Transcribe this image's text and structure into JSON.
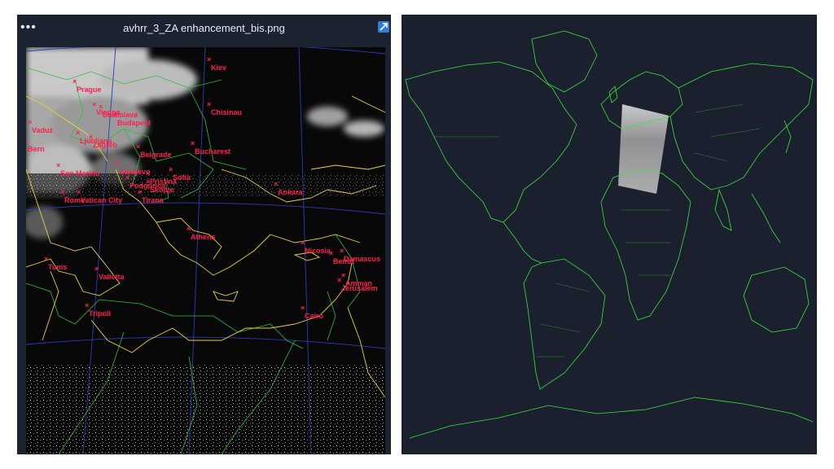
{
  "viewer": {
    "title": "avhrr_3_ZA enhancement_bis.png",
    "menu_icon": "more-dots-icon",
    "expand_icon": "open-external-icon",
    "menu_glyph": "•••"
  },
  "cities": [
    {
      "name": "Kiev"
    },
    {
      "name": "Prague"
    },
    {
      "name": "Vienna"
    },
    {
      "name": "Bratislava"
    },
    {
      "name": "Budapest"
    },
    {
      "name": "Chisinau"
    },
    {
      "name": "Vaduz"
    },
    {
      "name": "Bern"
    },
    {
      "name": "Ljubljana"
    },
    {
      "name": "Zagreb"
    },
    {
      "name": "Belgrade"
    },
    {
      "name": "Bucharest"
    },
    {
      "name": "Sarajevo"
    },
    {
      "name": "San Marino"
    },
    {
      "name": "Podgorica"
    },
    {
      "name": "Pristina"
    },
    {
      "name": "Sofia"
    },
    {
      "name": "Skopje"
    },
    {
      "name": "Tirana"
    },
    {
      "name": "Rome"
    },
    {
      "name": "Vatican City"
    },
    {
      "name": "Ankara"
    },
    {
      "name": "Athens"
    },
    {
      "name": "Nicosia"
    },
    {
      "name": "Beirut"
    },
    {
      "name": "Damascus"
    },
    {
      "name": "Tunis"
    },
    {
      "name": "Valletta"
    },
    {
      "name": "Amman"
    },
    {
      "name": "Jerusalem"
    },
    {
      "name": "Tripoli"
    },
    {
      "name": "Cairo"
    }
  ],
  "colors": {
    "city_label": "#ff1f4a",
    "coastline": "#e8d23a",
    "border": "#2fbf3a",
    "graticule": "#2b3db8",
    "world_coast": "#39e639"
  }
}
